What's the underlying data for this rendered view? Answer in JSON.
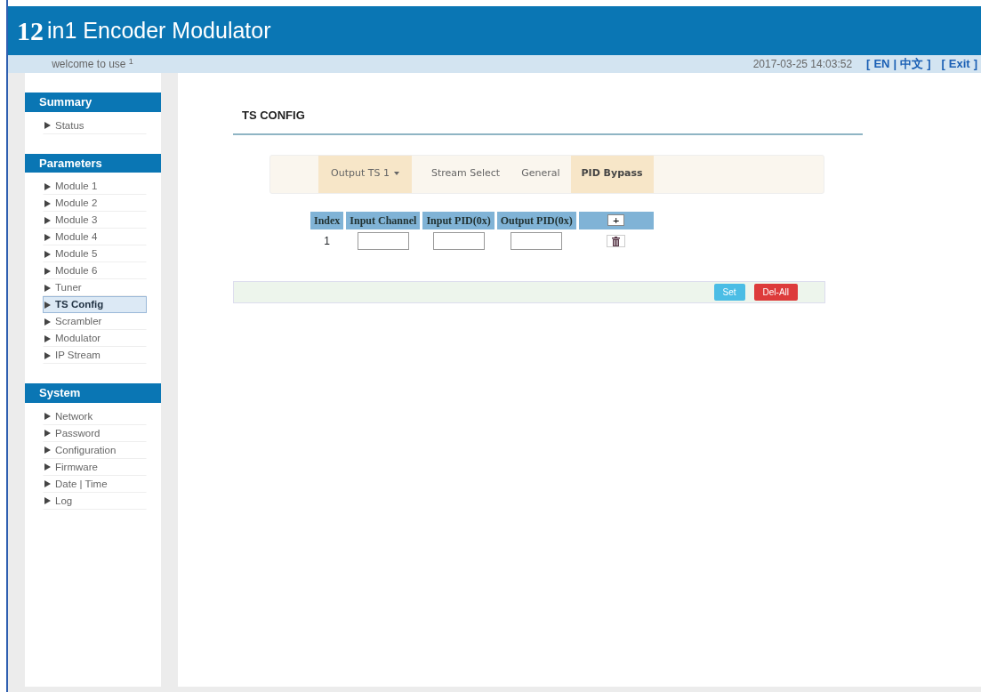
{
  "header": {
    "title_number": "12",
    "title": "in1 Encoder Modulator"
  },
  "subbar": {
    "welcome": "welcome to use $^{1}$",
    "datetime": "2017-03-25 14:03:52",
    "links": [
      {
        "text": "[",
        "kind": "bracket"
      },
      {
        "text": "EN",
        "kind": "link"
      },
      {
        "text": "|",
        "kind": "separator"
      },
      {
        "text": "中文",
        "kind": "link"
      },
      {
        "text": "]",
        "kind": "bracket"
      },
      {
        "text": "[",
        "kind": "bracket"
      },
      {
        "text": "Exit",
        "kind": "link"
      },
      {
        "text": "]",
        "kind": "bracket"
      }
    ]
  },
  "sidebar": [
    {
      "heading": "Summary",
      "items": [
        {
          "label": "Status",
          "selected": false
        }
      ]
    },
    {
      "heading": "Parameters",
      "items": [
        {
          "label": "Module 1",
          "selected": false
        },
        {
          "label": "Module 2",
          "selected": false
        },
        {
          "label": "Module 3",
          "selected": false
        },
        {
          "label": "Module 4",
          "selected": false
        },
        {
          "label": "Module 5",
          "selected": false
        },
        {
          "label": "Module 6",
          "selected": false
        },
        {
          "label": "Tuner",
          "selected": false
        },
        {
          "label": "TS Config",
          "selected": true
        },
        {
          "label": "Scrambler",
          "selected": false
        },
        {
          "label": "Modulator",
          "selected": false
        },
        {
          "label": "IP Stream",
          "selected": false
        }
      ]
    },
    {
      "heading": "System",
      "items": [
        {
          "label": "Network",
          "selected": false
        },
        {
          "label": "Password",
          "selected": false
        },
        {
          "label": "Configuration",
          "selected": false
        },
        {
          "label": "Firmware",
          "selected": false
        },
        {
          "label": "Date | Time",
          "selected": false
        },
        {
          "label": "Log",
          "selected": false
        }
      ]
    }
  ],
  "page_title": "TS CONFIG",
  "tabs": [
    {
      "label": "Output TS 1",
      "kind": "dropdown",
      "selected": true
    },
    {
      "label": "Stream Select",
      "kind": "tab",
      "selected": false
    },
    {
      "label": "General",
      "kind": "tab",
      "selected": false
    },
    {
      "label": "PID Bypass",
      "kind": "tab",
      "selected": true
    }
  ],
  "table": {
    "columns": [
      "Index",
      "Input Channel",
      "Input PID(0x)",
      "Output PID(0x)"
    ],
    "add_button": "+",
    "rows": [
      {
        "index": "1"
      }
    ]
  },
  "buttons": [
    {
      "label": "Set",
      "kind": "info"
    },
    {
      "label": "Del-All",
      "kind": "danger"
    }
  ]
}
